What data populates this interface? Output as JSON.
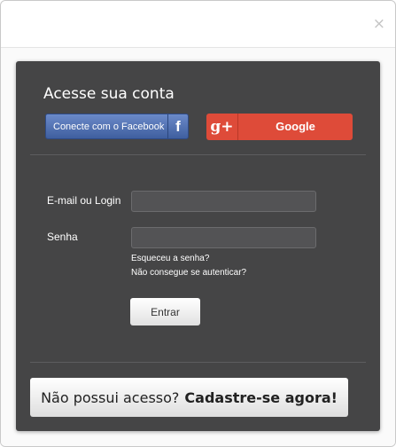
{
  "dialog": {
    "close_label": "×"
  },
  "login": {
    "title": "Acesse sua conta",
    "facebook_label": "Conecte com o Facebook",
    "facebook_icon_glyph": "f",
    "google_label": "Google",
    "google_icon_glyph": "g+",
    "email_label": "E-mail ou Login",
    "email_value": "",
    "password_label": "Senha",
    "password_value": "",
    "forgot_link": "Esqueceu a senha?",
    "cant_auth_link": "Não consegue se autenticar?",
    "submit_label": "Entrar",
    "signup_prefix": "Não possui acesso?",
    "signup_link": "Cadastre-se agora!"
  },
  "colors": {
    "panel_bg": "#454546",
    "facebook_blue": "#4a67a8",
    "google_red": "#de4b39"
  }
}
